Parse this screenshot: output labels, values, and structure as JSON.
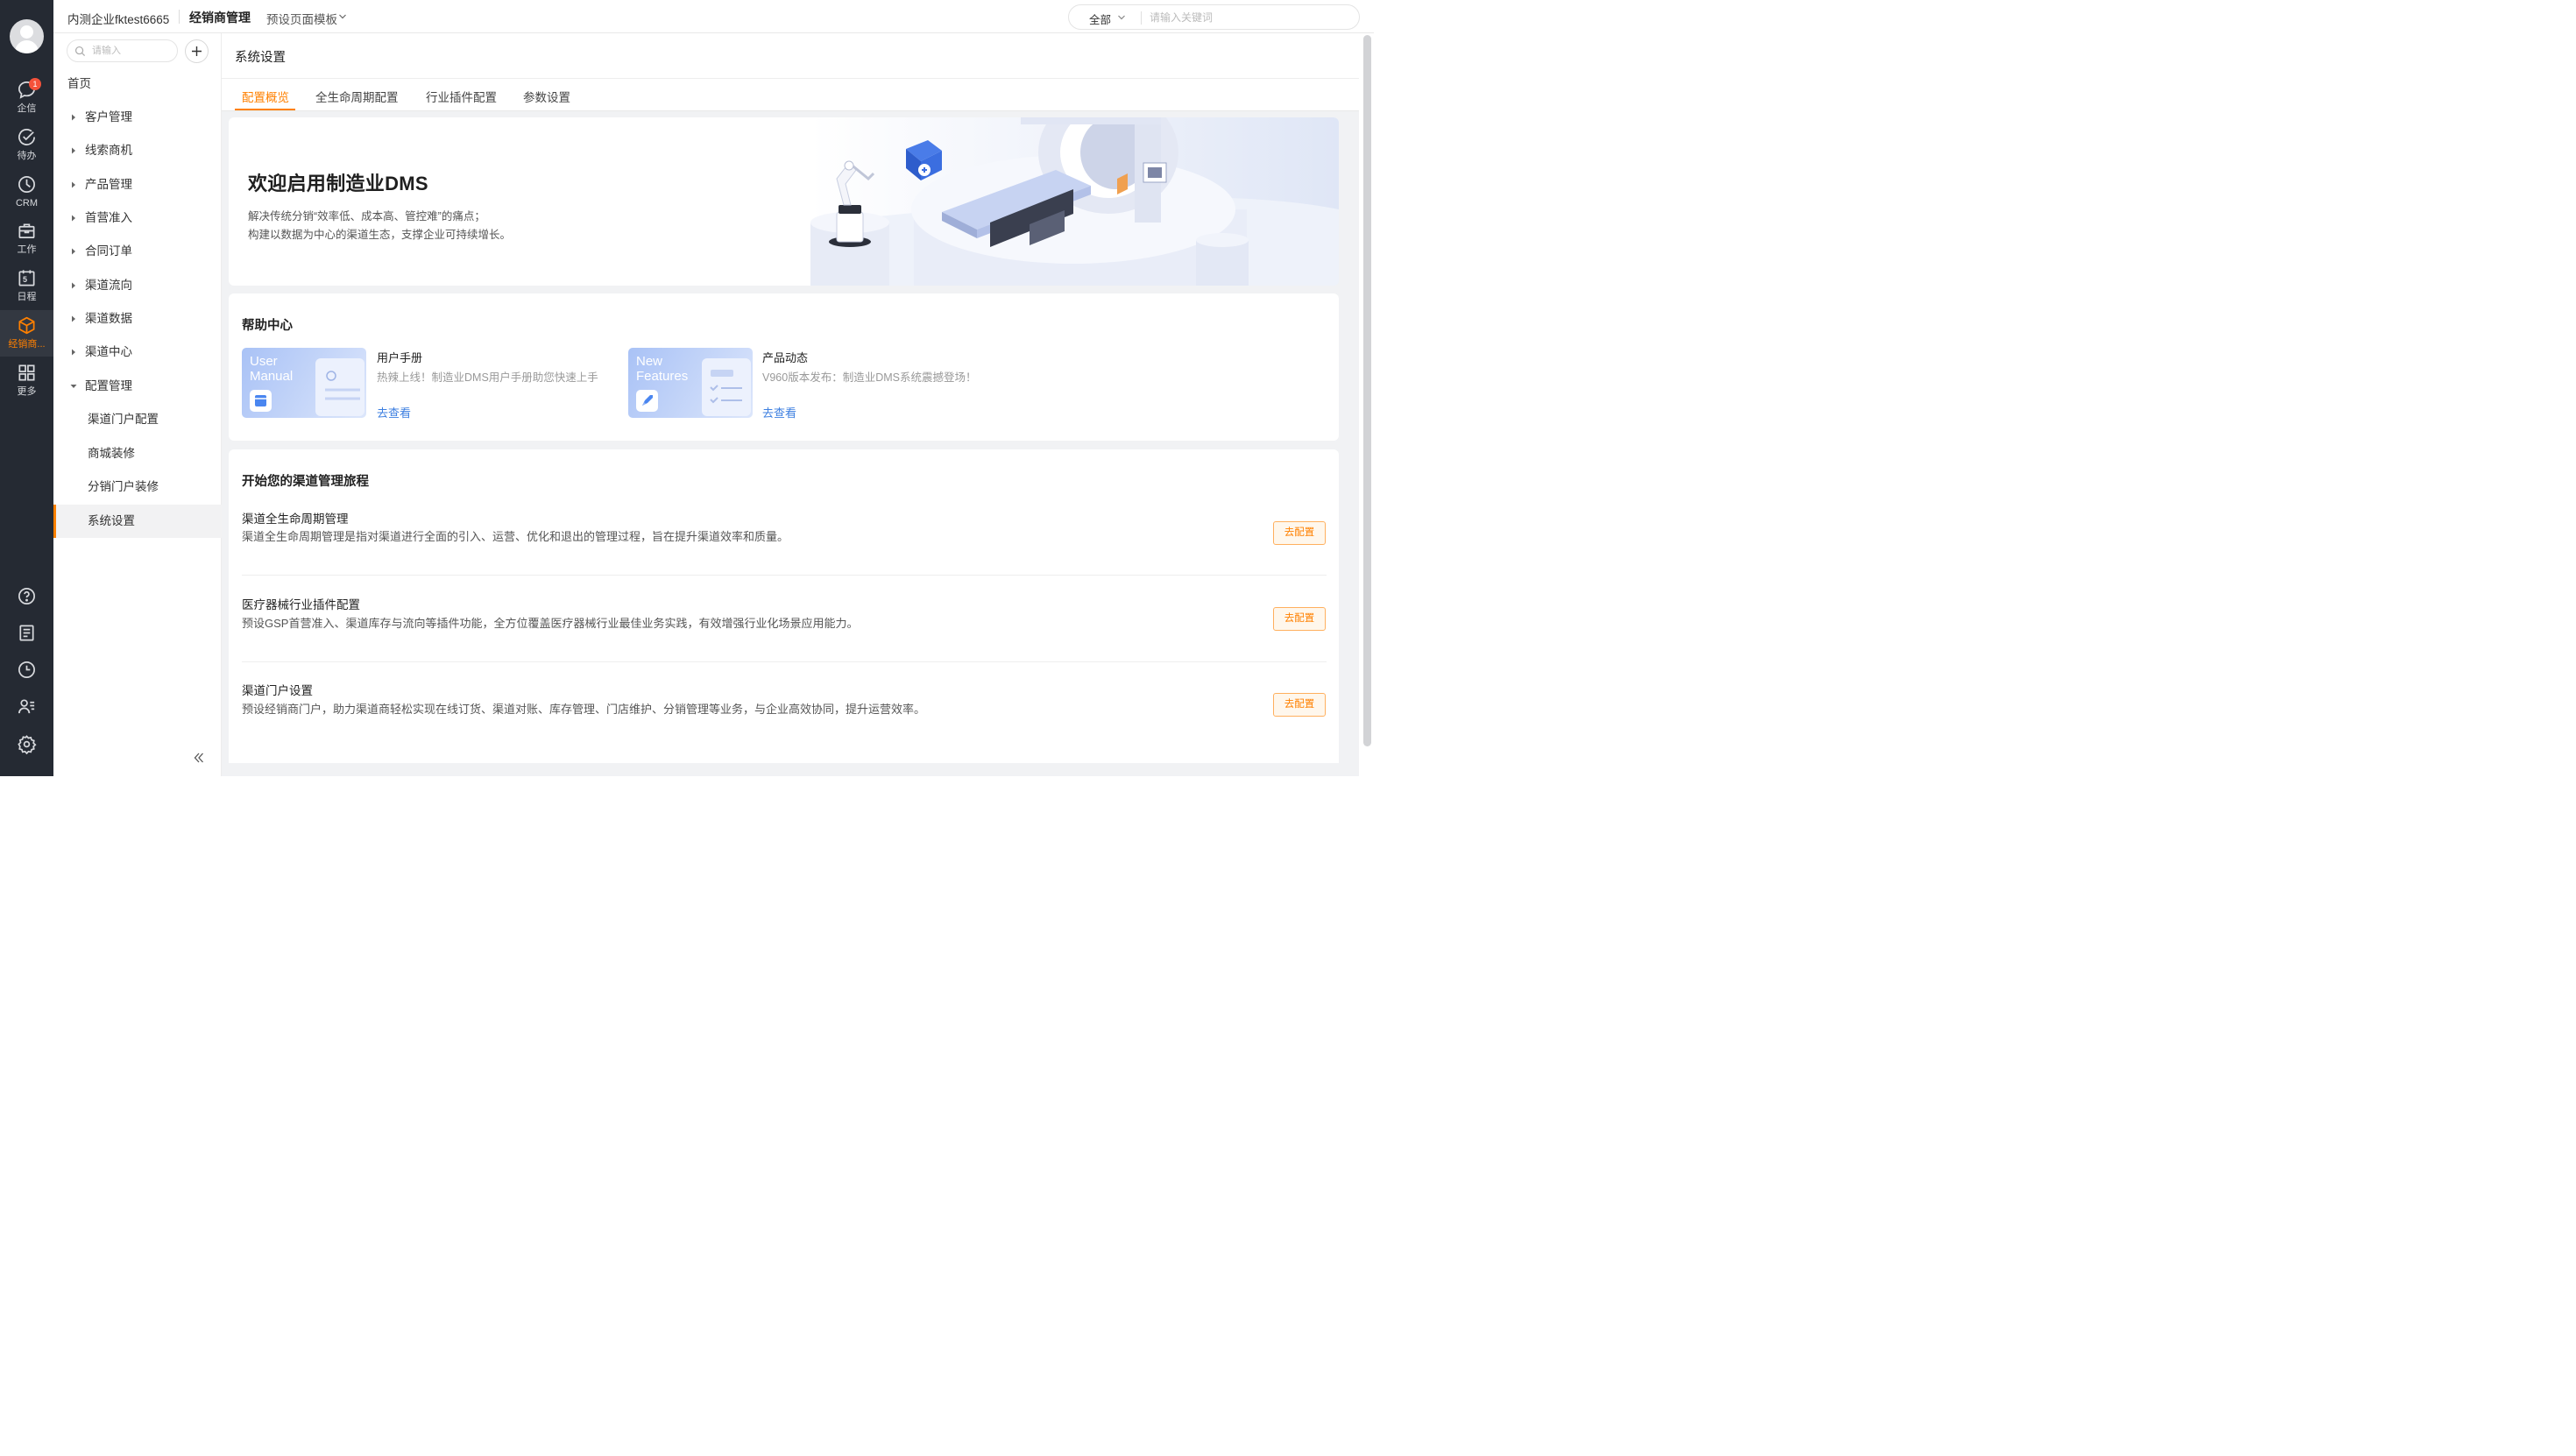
{
  "rail": {
    "items": [
      {
        "label": "企信",
        "icon": "chat-icon",
        "badge": "1"
      },
      {
        "label": "待办",
        "icon": "check-circle-icon"
      },
      {
        "label": "CRM",
        "icon": "clock-icon"
      },
      {
        "label": "工作",
        "icon": "briefcase-icon"
      },
      {
        "label": "日程",
        "icon": "calendar-icon",
        "day": "5"
      },
      {
        "label": "经销商...",
        "icon": "cube-icon",
        "active": true
      },
      {
        "label": "更多",
        "icon": "grid-icon"
      }
    ],
    "bottom_icons": [
      "help-icon",
      "document-icon",
      "history-icon",
      "contacts-icon",
      "settings-icon"
    ],
    "active_color": "#ff8000"
  },
  "topbar": {
    "company": "内测企业fktest6665",
    "app_name": "经销商管理",
    "template_menu": "预设页面模板",
    "search": {
      "scope": "全部",
      "placeholder": "请输入关键词"
    }
  },
  "nav": {
    "search_placeholder": "请输入",
    "home": "首页",
    "groups": [
      "客户管理",
      "线索商机",
      "产品管理",
      "首营准入",
      "合同订单",
      "渠道流向",
      "渠道数据",
      "渠道中心"
    ],
    "expanded_group": "配置管理",
    "sub_items": [
      "渠道门户配置",
      "商城装修",
      "分销门户装修",
      "系统设置"
    ],
    "selected_sub": "系统设置"
  },
  "page": {
    "title": "系统设置",
    "tabs": [
      "配置概览",
      "全生命周期配置",
      "行业插件配置",
      "参数设置"
    ],
    "active_tab": 0
  },
  "banner": {
    "title": "欢迎启用制造业DMS",
    "lines": [
      "解决传统分销“效率低、成本高、管控难”的痛点；",
      "构建以数据为中心的渠道生态，支撑企业可持续增长。"
    ]
  },
  "help_center": {
    "title": "帮助中心",
    "items": [
      {
        "thumb_line1": "User",
        "thumb_line2": "Manual",
        "name": "用户手册",
        "desc": "热辣上线！制造业DMS用户手册助您快速上手",
        "link": "去查看"
      },
      {
        "thumb_line1": "New",
        "thumb_line2": "Features",
        "name": "产品动态",
        "desc": "V960版本发布：制造业DMS系统震撼登场！",
        "link": "去查看"
      }
    ]
  },
  "journey": {
    "title": "开始您的渠道管理旅程",
    "rows": [
      {
        "title": "渠道全生命周期管理",
        "desc": "渠道全生命周期管理是指对渠道进行全面的引入、运营、优化和退出的管理过程，旨在提升渠道效率和质量。",
        "action": "去配置"
      },
      {
        "title": "医疗器械行业插件配置",
        "desc": "预设GSP首营准入、渠道库存与流向等插件功能，全方位覆盖医疗器械行业最佳业务实践，有效增强行业化场景应用能力。",
        "action": "去配置"
      },
      {
        "title": "渠道门户设置",
        "desc": "预设经销商门户，助力渠道商轻松实现在线订货、渠道对账、库存管理、门店维护、分销管理等业务，与企业高效协同，提升运营效率。",
        "action": "去配置"
      }
    ]
  }
}
